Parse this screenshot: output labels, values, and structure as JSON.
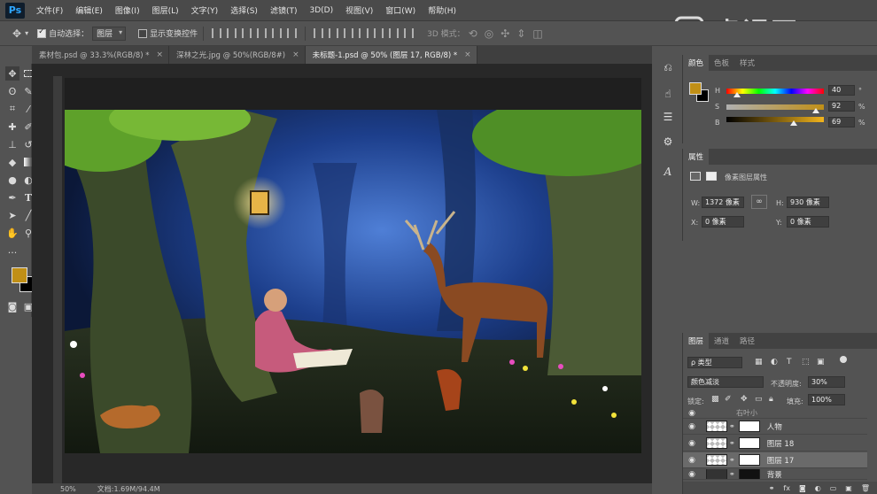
{
  "app": {
    "logo": "Ps",
    "watermark": "虎课网"
  },
  "menu": [
    "文件(F)",
    "编辑(E)",
    "图像(I)",
    "图层(L)",
    "文字(Y)",
    "选择(S)",
    "滤镜(T)",
    "3D(D)",
    "视图(V)",
    "窗口(W)",
    "帮助(H)"
  ],
  "options": {
    "auto_select_label": "自动选择：",
    "auto_select_value": "图层",
    "show_transform_label": "显示变换控件",
    "mode_3d_label": "3D 模式："
  },
  "tabs": [
    {
      "label": "素材包.psd @ 33.3%(RGB/8) *",
      "close": "×"
    },
    {
      "label": "深林之光.jpg @ 50%(RGB/8#)",
      "close": "×"
    },
    {
      "label": "未标题-1.psd @ 50% (图层 17, RGB/8) *",
      "close": "×"
    }
  ],
  "status": {
    "zoom": "50%",
    "doc": "文档:1.69M/94.4M"
  },
  "colors": {
    "foreground": "#c08f16",
    "background": "#000000",
    "accent_panel": "#535353"
  },
  "color_panel": {
    "tabs": [
      "颜色",
      "色板",
      "样式"
    ],
    "h_label": "H",
    "s_label": "S",
    "b_label": "B",
    "h_value": "40",
    "s_value": "92",
    "b_value": "69",
    "h_unit": "°",
    "s_unit": "%",
    "b_unit": "%",
    "h_level": 0.11,
    "s_level": 0.92,
    "b_level": 0.69
  },
  "properties_panel": {
    "title": "属性",
    "subtitle": "像素图层属性",
    "w_label": "W:",
    "w_value": "1372 像素",
    "h_label": "H:",
    "h_value": "930 像素",
    "x_label": "X:",
    "x_value": "0 像素",
    "y_label": "Y:",
    "y_value": "0 像素"
  },
  "layers_panel": {
    "tabs": [
      "图层",
      "通道",
      "路径"
    ],
    "filter_label": "ρ 类型",
    "blend_mode": "颜色减淡",
    "opacity_label": "不透明度:",
    "opacity_value": "30%",
    "lock_label": "锁定:",
    "fill_label": "填充:",
    "fill_value": "100%",
    "layers": [
      {
        "name": "右叶小",
        "selected": false
      },
      {
        "name": "人物",
        "selected": false
      },
      {
        "name": "图层 18",
        "selected": false
      },
      {
        "name": "图层 17",
        "selected": true
      },
      {
        "name": "背景",
        "selected": false
      }
    ]
  },
  "icons": [
    "move-icon",
    "marquee-icon",
    "lasso-icon",
    "quick-select-icon",
    "crop-icon",
    "eyedropper-icon",
    "healing-icon",
    "brush-icon",
    "stamp-icon",
    "history-brush-icon",
    "eraser-icon",
    "gradient-icon",
    "blur-icon",
    "dodge-icon",
    "pen-icon",
    "type-icon",
    "path-select-icon",
    "line-icon",
    "hand-icon",
    "zoom-icon",
    "more-icon"
  ]
}
